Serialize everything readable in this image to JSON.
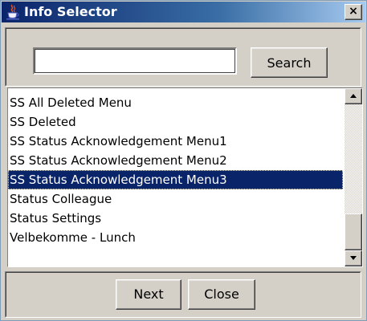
{
  "window": {
    "title": "Info Selector",
    "close_glyph": "×",
    "icon": "java-cup-icon"
  },
  "search": {
    "value": "",
    "placeholder": "",
    "button_label": "Search"
  },
  "list": {
    "items": [
      {
        "label": "SS All Deleted Menu",
        "selected": false
      },
      {
        "label": "SS Deleted",
        "selected": false
      },
      {
        "label": "SS Status Acknowledgement Menu1",
        "selected": false
      },
      {
        "label": "SS Status Acknowledgement Menu2",
        "selected": false
      },
      {
        "label": "SS Status Acknowledgement Menu3",
        "selected": true
      },
      {
        "label": "Status Colleague",
        "selected": false
      },
      {
        "label": "Status Settings",
        "selected": false
      },
      {
        "label": "Velbekomme - Lunch",
        "selected": false
      }
    ],
    "selection_color": "#0a246a"
  },
  "buttons": {
    "next_label": "Next",
    "close_label": "Close"
  },
  "colors": {
    "titlebar_start": "#0a246a",
    "titlebar_end": "#a6caf0",
    "face": "#d4d0c8"
  }
}
